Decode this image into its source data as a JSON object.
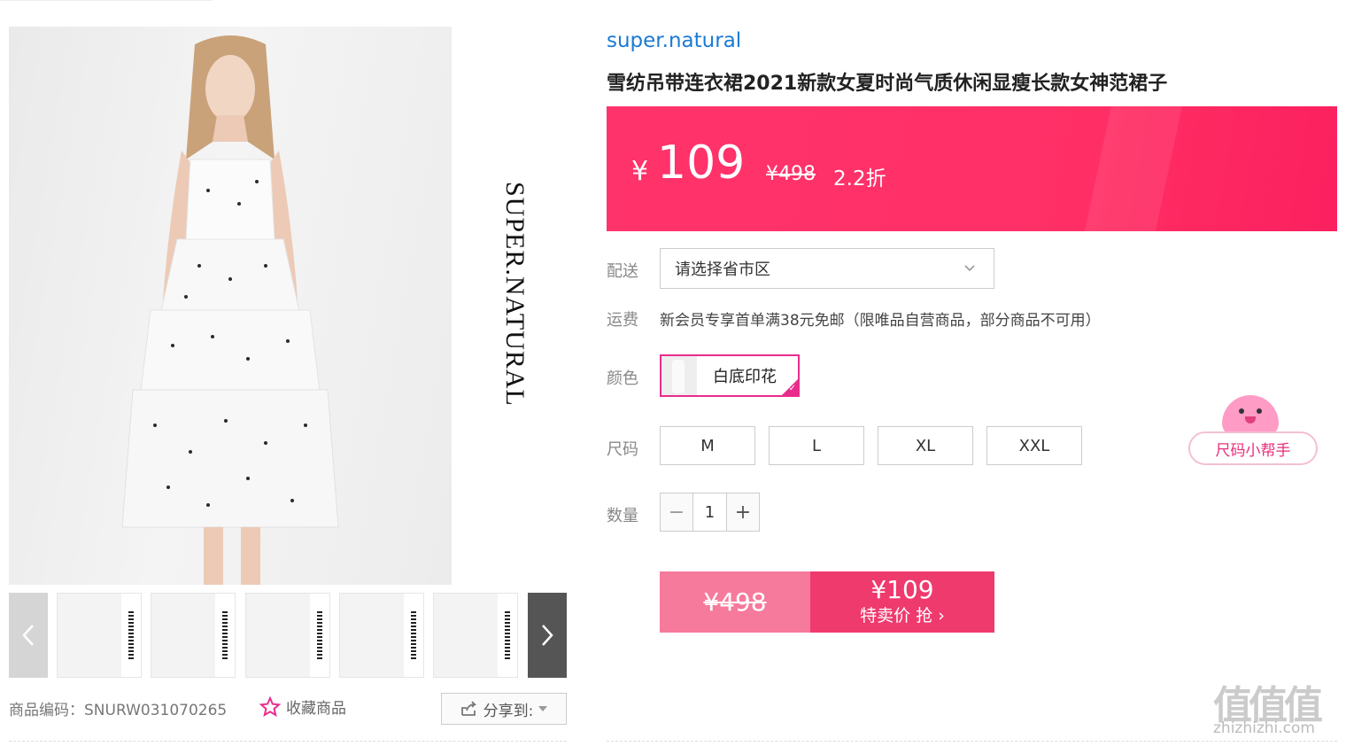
{
  "gallery": {
    "vertical_brand": "SUPER.NATURAL",
    "thumb_count": 6
  },
  "product": {
    "brand": "super.natural",
    "title": "雪纺吊带连衣裙2021新款女夏时尚气质休闲显瘦长款女神范裙子",
    "code_text": "商品编码：SNURW031070265",
    "favorite_label": "收藏商品",
    "share_label": "分享到:"
  },
  "price": {
    "currency": "¥",
    "current": "109",
    "original": "¥498",
    "discount": "2.2折"
  },
  "shipping": {
    "label": "配送",
    "select_value": "请选择省市区"
  },
  "fee": {
    "label": "运费",
    "text": "新会员专享首单满38元免邮（限唯品自营商品，部分商品不可用）"
  },
  "color": {
    "label": "颜色",
    "selected": "白底印花"
  },
  "size": {
    "label": "尺码",
    "options": [
      "M",
      "L",
      "XL",
      "XXL"
    ],
    "helper": "尺码小帮手"
  },
  "quantity": {
    "label": "数量",
    "value": "1",
    "minus": "−",
    "plus": "+"
  },
  "buy": {
    "original": "¥498",
    "price": "¥109",
    "label": "特卖价 抢 ›"
  },
  "watermark": {
    "logo": "值值值",
    "url": "zhizhizhi.com"
  },
  "colors": {
    "accent": "#ff2f66",
    "brand_link": "#1a7ad4",
    "selected_border": "#e92c8c"
  }
}
